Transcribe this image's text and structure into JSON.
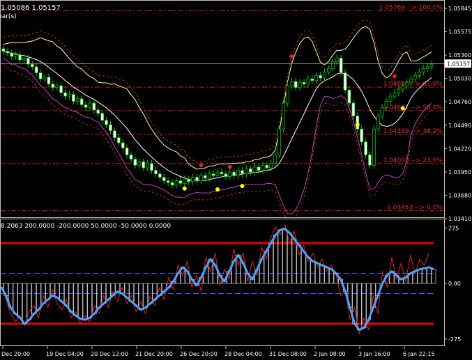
{
  "chart_data": [
    {
      "type": "candlestick",
      "header_text": "1.05086 1.05157",
      "header_sub": "bar(s)",
      "price_axis_ticks": [
        "1.05845",
        "1.05575",
        "1.05300",
        "1.05030",
        "1.04760",
        "1.04490",
        "1.04220",
        "1.03950",
        "1.03680",
        "1.03410"
      ],
      "ylim": [
        1.0341,
        1.05845
      ],
      "current_price": "1.05157",
      "fib_levels": [
        {
          "price": 1.05769,
          "label": "1.05769 --> 100.0%"
        },
        {
          "price": 1.04885,
          "label": "1.04885 --> 61.8%"
        },
        {
          "price": 1.04611,
          "label": "1.04611 --> 50.0%"
        },
        {
          "price": 1.04339,
          "label": "1.04339 --> 38.2%"
        },
        {
          "price": 1.04,
          "label": "1.04000 --> 23.6%"
        },
        {
          "price": 1.03453,
          "label": "1.03453 --> 0.0%"
        }
      ],
      "time_labels": [
        "Dec 20:00",
        "19 Dec 04:00",
        "20 Dec 12:00",
        "21 Dec 20:00",
        "26 Dec 20:00",
        "28 Dec 04:00",
        "31 Dec 08:00",
        "2 Jan 08:00",
        "3 Jan 16:00",
        "6 Jan 22:15"
      ],
      "closes": [
        1.053,
        1.0528,
        1.0524,
        1.0526,
        1.052,
        1.0522,
        1.0515,
        1.0512,
        1.0505,
        1.0498,
        1.05,
        1.0492,
        1.0488,
        1.049,
        1.0482,
        1.0478,
        1.048,
        1.0472,
        1.0475,
        1.0468,
        1.0465,
        1.047,
        1.0462,
        1.0458,
        1.045,
        1.0445,
        1.0438,
        1.043,
        1.0424,
        1.0418,
        1.041,
        1.0405,
        1.0398,
        1.0402,
        1.0395,
        1.04,
        1.0392,
        1.0388,
        1.0384,
        1.038,
        1.0378,
        1.0375,
        1.038,
        1.0377,
        1.0382,
        1.0379,
        1.0384,
        1.038,
        1.0386,
        1.0383,
        1.0388,
        1.0386,
        1.039,
        1.0388,
        1.0385,
        1.039,
        1.0386,
        1.0392,
        1.0388,
        1.0394,
        1.039,
        1.0396,
        1.0392,
        1.0398,
        1.0395,
        1.04,
        1.041,
        1.044,
        1.047,
        1.049,
        1.0495,
        1.0488,
        1.0494,
        1.0492,
        1.0498,
        1.0496,
        1.0502,
        1.0499,
        1.0506,
        1.051,
        1.0518,
        1.0522,
        1.0505,
        1.0485,
        1.047,
        1.0455,
        1.044,
        1.0425,
        1.041,
        1.0398,
        1.044,
        1.0455,
        1.0465,
        1.0472,
        1.0478,
        1.0482,
        1.0486,
        1.049,
        1.0494,
        1.0498,
        1.0502,
        1.0506,
        1.051,
        1.0512,
        1.0515
      ],
      "up_fractals": [
        {
          "bar": 70,
          "price": 1.0524
        },
        {
          "bar": 48,
          "price": 1.0398
        },
        {
          "bar": 55,
          "price": 1.0396
        },
        {
          "bar": 95,
          "price": 1.0501
        }
      ],
      "down_fractals": [
        {
          "bar": 44,
          "price": 1.0371
        },
        {
          "bar": 52,
          "price": 1.037
        },
        {
          "bar": 58,
          "price": 1.0374
        },
        {
          "bar": 86,
          "price": 1.0445
        },
        {
          "bar": 97,
          "price": 1.0464
        }
      ]
    },
    {
      "type": "line",
      "header_text": "8.2063 200.0000 -200.0000 50.0000 -50.0000 0.0000",
      "axis_ticks": [
        "275",
        "0.00",
        "-275"
      ],
      "ylim": [
        -300,
        300
      ],
      "levels": [
        200,
        50,
        0,
        -50,
        -200
      ],
      "series": [
        {
          "values": [
            -20,
            -60,
            -120,
            -150,
            -170,
            -200,
            -180,
            -150,
            -130,
            -100,
            -80,
            -60,
            -70,
            -90,
            -110,
            -140,
            -160,
            -175,
            -180,
            -170,
            -150,
            -120,
            -100,
            -80,
            -60,
            -40,
            -50,
            -70,
            -90,
            -110,
            -130,
            -120,
            -100,
            -80,
            -60,
            -40,
            -20,
            10,
            50,
            80,
            60,
            20,
            -10,
            30,
            80,
            120,
            90,
            40,
            10,
            60,
            110,
            140,
            100,
            50,
            20,
            70,
            120,
            160,
            200,
            240,
            265,
            270,
            250,
            220,
            190,
            160,
            130,
            110,
            100,
            90,
            80,
            70,
            50,
            20,
            -40,
            -120,
            -200,
            -230,
            -220,
            -180,
            -120,
            -60,
            0,
            40,
            60,
            40,
            20,
            30,
            50,
            60,
            70,
            75,
            80,
            70
          ]
        },
        {
          "values": [
            -10,
            -80,
            -150,
            -190,
            -160,
            -210,
            -140,
            -110,
            -170,
            -60,
            -120,
            -30,
            -100,
            -130,
            -80,
            -170,
            -140,
            -200,
            -160,
            -190,
            -110,
            -150,
            -60,
            -120,
            -40,
            -90,
            -20,
            -100,
            -60,
            -140,
            -90,
            -150,
            -60,
            -110,
            -20,
            -80,
            30,
            -30,
            90,
            40,
            110,
            -20,
            40,
            -40,
            130,
            60,
            150,
            -10,
            70,
            20,
            170,
            90,
            150,
            10,
            110,
            40,
            180,
            120,
            230,
            280,
            240,
            290,
            200,
            260,
            140,
            190,
            110,
            150,
            80,
            120,
            60,
            90,
            40,
            -60,
            -30,
            -180,
            -120,
            -250,
            -170,
            -230,
            -60,
            -150,
            60,
            -20,
            130,
            20,
            100,
            10,
            140,
            50,
            120,
            90,
            150
          ]
        }
      ]
    }
  ]
}
